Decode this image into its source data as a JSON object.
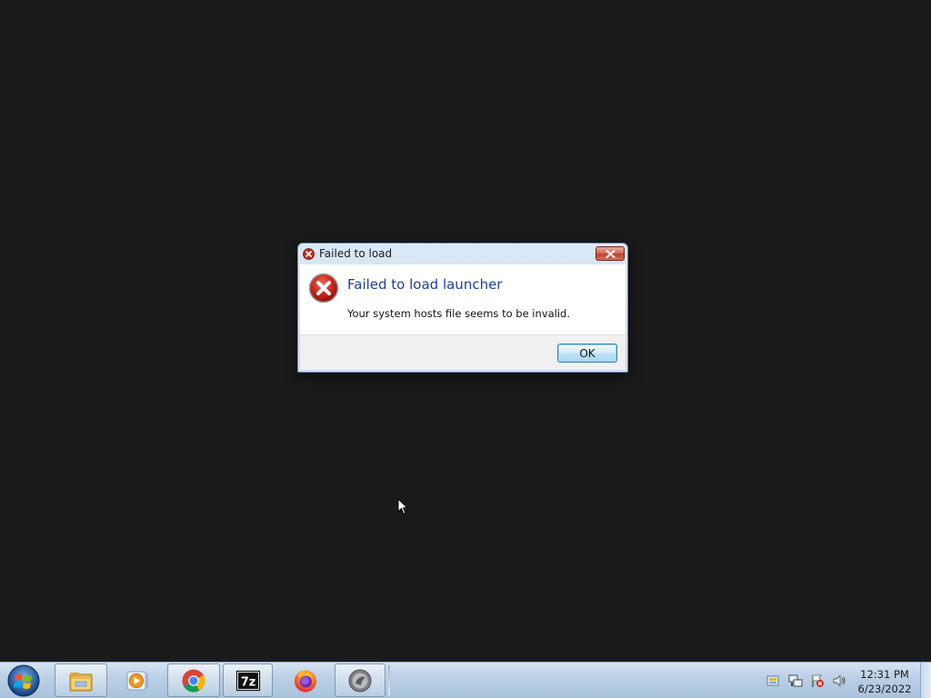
{
  "dialog": {
    "title": "Failed to load",
    "main_instruction": "Failed to load launcher",
    "message": "Your system hosts file seems to be invalid.",
    "ok_label": "OK",
    "title_icon": "error-icon",
    "content_icon": "error-icon"
  },
  "taskbar": {
    "start_icon": "windows-start-icon",
    "pinned": [
      {
        "name": "file-explorer-icon"
      },
      {
        "name": "media-player-icon"
      },
      {
        "name": "chrome-icon"
      },
      {
        "name": "7zip-icon",
        "text": "7z"
      },
      {
        "name": "firefox-icon"
      },
      {
        "name": "app-icon"
      }
    ],
    "tray_icons": [
      "action-center-icon",
      "network-icon",
      "flag-icon",
      "volume-icon"
    ],
    "clock": {
      "time": "12:31 PM",
      "date": "6/23/2022"
    }
  },
  "colors": {
    "desktop": "#1a1a1a",
    "instruction_text": "#1e3f96",
    "taskbar": "#bcd0e6"
  }
}
